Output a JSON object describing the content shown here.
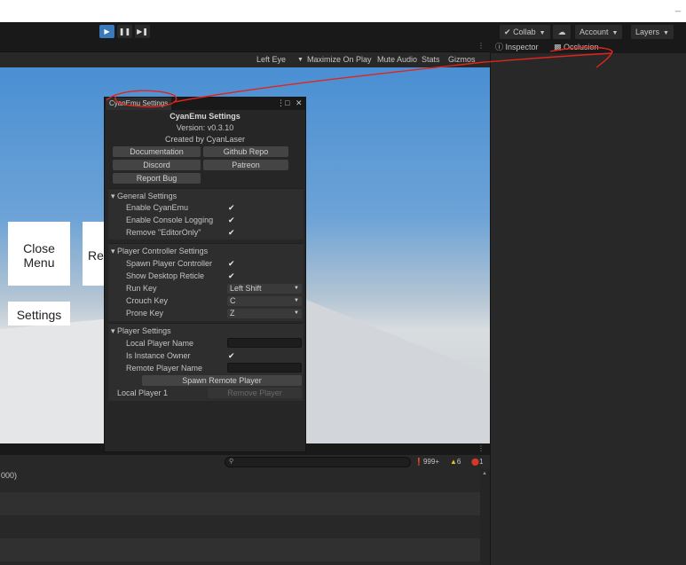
{
  "toolbar": {
    "play_icon": "play-icon",
    "pause_icon": "pause-icon",
    "step_icon": "step-icon",
    "collab": "Collab",
    "account": "Account",
    "layers": "Layers",
    "minimize": "_"
  },
  "game_view": {
    "toolbar": {
      "display": "Left Eye",
      "maximize": "Maximize On Play",
      "mute": "Mute Audio",
      "stats": "Stats",
      "gizmos": "Gizmos"
    },
    "buttons": {
      "close_menu_line1": "Close",
      "close_menu_line2": "Menu",
      "respawn": "Re",
      "settings": "Settings"
    }
  },
  "inspector": {
    "tab_inspector": "Inspector",
    "tab_occlusion": "Occlusion"
  },
  "console": {
    "counts": {
      "info": "999+",
      "warn": "6",
      "error": "1"
    },
    "rows": [
      "000)",
      "",
      "",
      ""
    ]
  },
  "cyanemu": {
    "tab_title": "CyanEmu Settings",
    "heading": "CyanEmu Settings",
    "version": "Version: v0.3.10",
    "created_by": "Created by CyanLaser",
    "buttons": {
      "documentation": "Documentation",
      "github": "Github Repo",
      "discord": "Discord",
      "patreon": "Patreon",
      "report_bug": "Report Bug"
    },
    "general": {
      "title": "General Settings",
      "items": [
        {
          "label": "Enable CyanEmu",
          "checked": true
        },
        {
          "label": "Enable Console Logging",
          "checked": true
        },
        {
          "label": "Remove \"EditorOnly\"",
          "checked": true
        }
      ]
    },
    "player_controller": {
      "title": "Player Controller Settings",
      "spawn_label": "Spawn Player Controller",
      "reticle_label": "Show Desktop Reticle",
      "run_key_label": "Run Key",
      "run_key_value": "Left Shift",
      "crouch_key_label": "Crouch Key",
      "crouch_key_value": "C",
      "prone_key_label": "Prone Key",
      "prone_key_value": "Z"
    },
    "player": {
      "title": "Player Settings",
      "local_name_label": "Local Player Name",
      "local_name_value": "",
      "instance_owner_label": "Is Instance Owner",
      "remote_name_label": "Remote Player Name",
      "remote_name_value": "",
      "spawn_remote": "Spawn Remote Player",
      "local_player": "Local Player 1",
      "remove_player": "Remove Player"
    }
  },
  "colors": {
    "play_active": "#3a79bb",
    "annotation_red": "#e0251b",
    "warn": "#e8c12a",
    "error": "#d9362b"
  }
}
